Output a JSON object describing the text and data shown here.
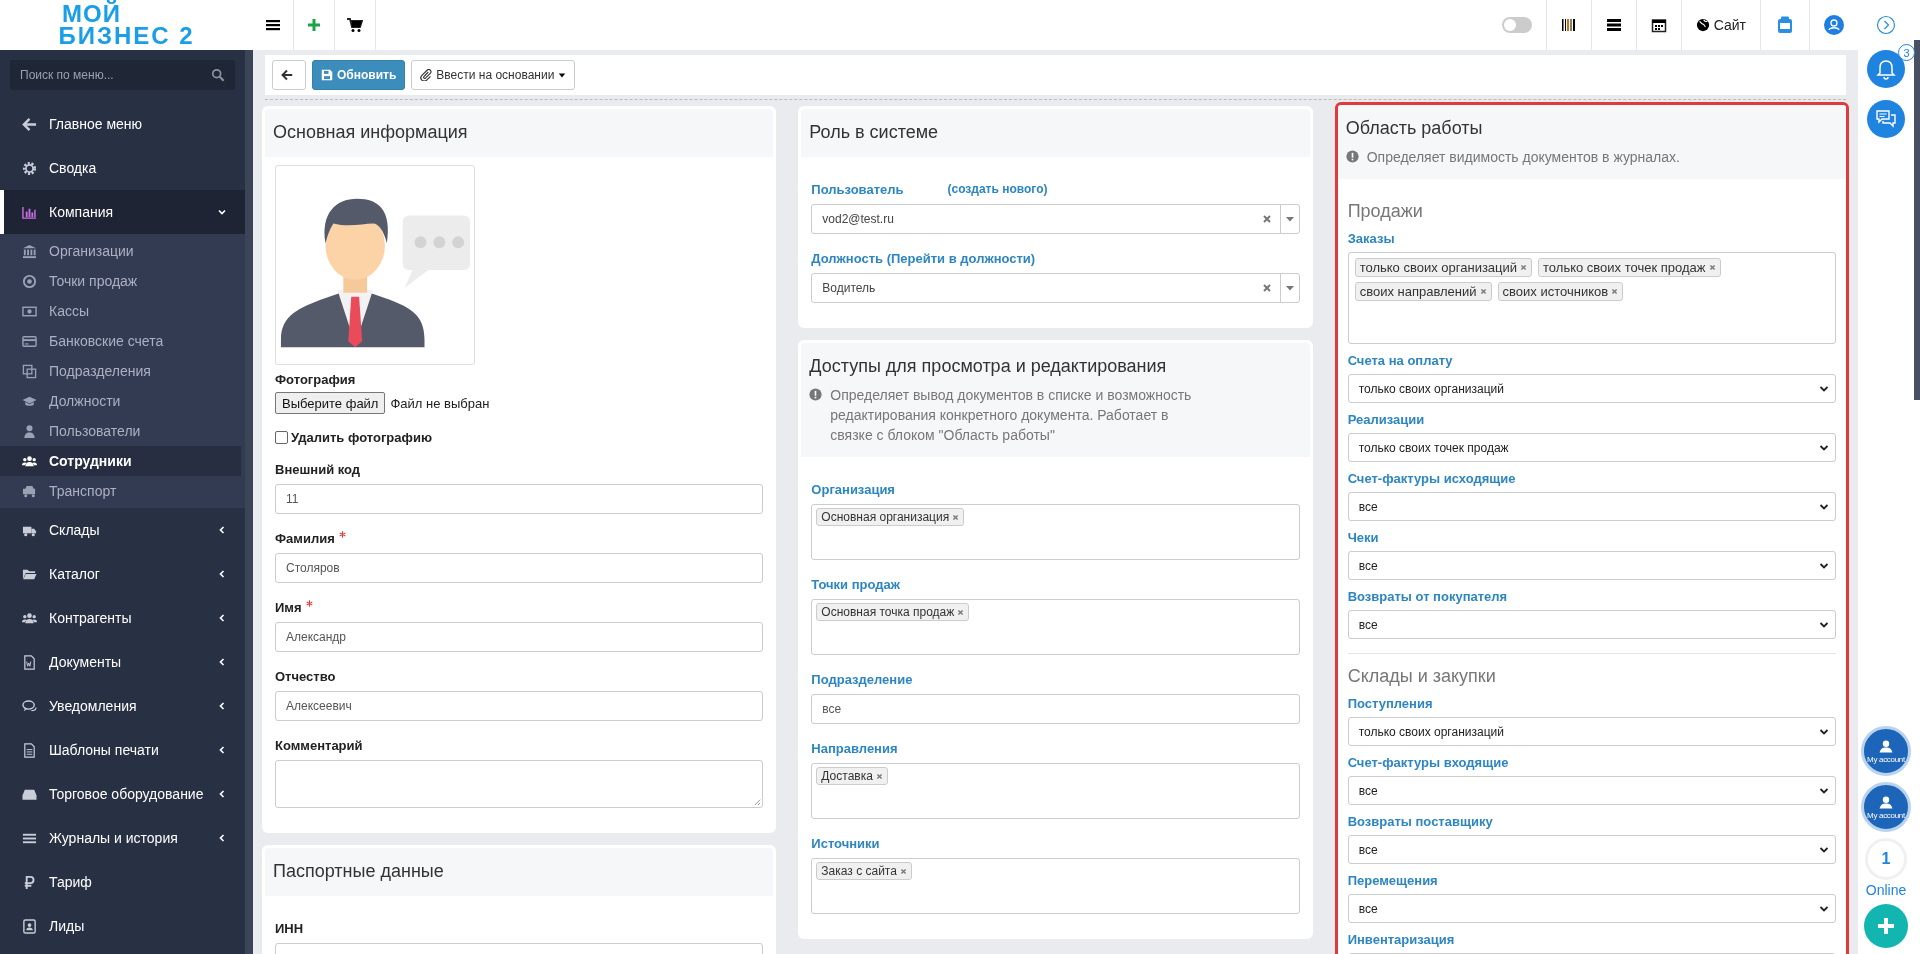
{
  "logo": {
    "line1": "МОЙ",
    "line2": "БИЗНЕС 2"
  },
  "sidebar": {
    "search_placeholder": "Поиск по меню...",
    "items": [
      {
        "label": "Главное меню",
        "kind": "link",
        "selected": false
      },
      {
        "label": "Сводка",
        "kind": "link",
        "selected": false
      },
      {
        "label": "Компания",
        "kind": "group",
        "expanded": true,
        "selected": true,
        "children": [
          {
            "label": "Организации",
            "selected": false
          },
          {
            "label": "Точки продаж",
            "selected": false
          },
          {
            "label": "Кассы",
            "selected": false
          },
          {
            "label": "Банковские счета",
            "selected": false
          },
          {
            "label": "Подразделения",
            "selected": false
          },
          {
            "label": "Должности",
            "selected": false
          },
          {
            "label": "Пользователи",
            "selected": false
          },
          {
            "label": "Сотрудники",
            "selected": true
          },
          {
            "label": "Транспорт",
            "selected": false
          }
        ]
      },
      {
        "label": "Склады",
        "kind": "group",
        "expanded": false,
        "selected": false
      },
      {
        "label": "Каталог",
        "kind": "group",
        "expanded": false,
        "selected": false
      },
      {
        "label": "Контрагенты",
        "kind": "group",
        "expanded": false,
        "selected": false
      },
      {
        "label": "Документы",
        "kind": "group",
        "expanded": false,
        "selected": false
      },
      {
        "label": "Уведомления",
        "kind": "group",
        "expanded": false,
        "selected": false
      },
      {
        "label": "Шаблоны печати",
        "kind": "group",
        "expanded": false,
        "selected": false
      },
      {
        "label": "Торговое оборудование",
        "kind": "group",
        "expanded": false,
        "selected": false
      },
      {
        "label": "Журналы и история",
        "kind": "group",
        "expanded": false,
        "selected": false
      },
      {
        "label": "Тариф",
        "kind": "link",
        "selected": false
      },
      {
        "label": "Лиды",
        "kind": "link",
        "selected": false
      }
    ]
  },
  "topbar": {
    "dark_mode_toggle": {
      "on": false
    },
    "site_link": "Сайт"
  },
  "right_rail": {
    "notifications_badge": "3",
    "account_labels": [
      "My account",
      "My account"
    ],
    "online_count": "1",
    "online_label": "Online"
  },
  "toolbar": {
    "buttons": [
      {
        "kind": "back"
      },
      {
        "kind": "primary",
        "label": "Обновить"
      },
      {
        "kind": "dropdown",
        "label": "Ввести на основании"
      }
    ]
  },
  "columns": [
    {
      "panels": [
        {
          "title": "Основная информация",
          "highlighted": false,
          "fields": [
            {
              "kind": "photo",
              "label": "Фотография",
              "button": "Выберите файл",
              "file_status": "Файл не выбран"
            },
            {
              "kind": "checkbox",
              "label": "Удалить фотографию",
              "checked": false
            },
            {
              "kind": "text",
              "label": "Внешний код",
              "value": "11",
              "required": false
            },
            {
              "kind": "text",
              "label": "Фамилия",
              "value": "Столяров",
              "required": true
            },
            {
              "kind": "text",
              "label": "Имя",
              "value": "Александр",
              "required": true
            },
            {
              "kind": "text",
              "label": "Отчество",
              "value": "Алексеевич",
              "required": false
            },
            {
              "kind": "textarea",
              "label": "Комментарий",
              "required": false
            }
          ]
        },
        {
          "title": "Паспортные данные",
          "highlighted": false,
          "fields": [
            {
              "kind": "text",
              "label": "ИНН",
              "required": false
            }
          ]
        }
      ]
    },
    {
      "panels": [
        {
          "title": "Роль в системе",
          "highlighted": false,
          "fields": [
            {
              "kind": "select2",
              "label": "Пользователь",
              "link": "(создать нового)",
              "value": "vod2@test.ru"
            },
            {
              "kind": "select2",
              "label": "Должность (Перейти в должности)",
              "value": "Водитель"
            }
          ]
        },
        {
          "title": "Доступы для просмотра и редактирования",
          "info": "Определяет вывод документов в списке и возможность редактирования конкретного документа. Работает в связке с блоком \"Область работы\"",
          "highlighted": false,
          "fields": [
            {
              "kind": "tags",
              "label": "Организация",
              "tags": [
                "Основная организация"
              ]
            },
            {
              "kind": "tags",
              "label": "Точки продаж",
              "tags": [
                "Основная точка продаж"
              ]
            },
            {
              "kind": "text",
              "label": "Подразделение",
              "value": "все",
              "required": false
            },
            {
              "kind": "tags",
              "label": "Направления",
              "tags": [
                "Доставка"
              ]
            },
            {
              "kind": "tags",
              "label": "Источники",
              "tags": [
                "Заказ с сайта"
              ]
            }
          ]
        }
      ]
    },
    {
      "panels": [
        {
          "title": "Область работы",
          "info": "Определяет видимость документов в журналах.",
          "highlighted": true,
          "fields": [
            {
              "kind": "heading",
              "text": "Продажи"
            },
            {
              "kind": "tags",
              "label": "Заказы",
              "tags": [
                "только своих организаций",
                "только своих точек продаж",
                "своих направлений",
                "своих источников"
              ]
            },
            {
              "kind": "select",
              "label": "Счета на оплату",
              "value": "только своих организаций"
            },
            {
              "kind": "select",
              "label": "Реализации",
              "value": "только своих точек продаж"
            },
            {
              "kind": "select",
              "label": "Счет-фактуры исходящие",
              "value": "все"
            },
            {
              "kind": "select",
              "label": "Чеки",
              "value": "все"
            },
            {
              "kind": "select",
              "label": "Возвраты от покупателя",
              "value": "все"
            },
            {
              "kind": "heading",
              "text": "Склады и закупки"
            },
            {
              "kind": "select",
              "label": "Поступления",
              "value": "только своих организаций"
            },
            {
              "kind": "select",
              "label": "Счет-фактуры входящие",
              "value": "все"
            },
            {
              "kind": "select",
              "label": "Возвраты поставщику",
              "value": "все"
            },
            {
              "kind": "select",
              "label": "Перемещения",
              "value": "все"
            },
            {
              "kind": "select",
              "label": "Инвентаризация"
            }
          ]
        }
      ]
    }
  ]
}
